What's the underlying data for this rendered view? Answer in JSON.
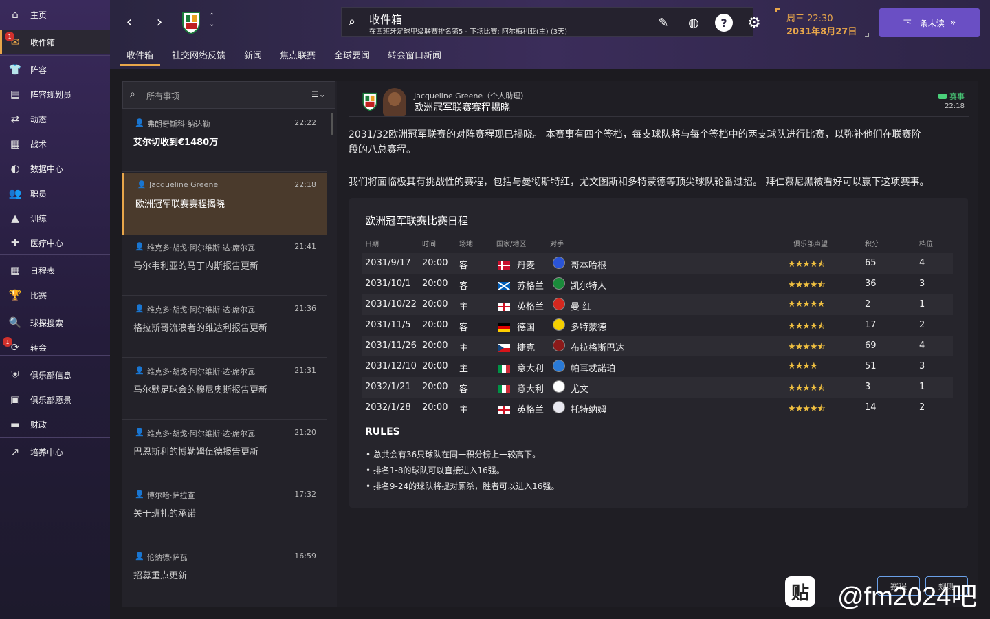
{
  "sidebar": {
    "items": [
      {
        "label": "主页",
        "icon": "home-icon",
        "glyph": "⌂"
      },
      {
        "label": "收件箱",
        "icon": "inbox-icon",
        "glyph": "✉",
        "badge": "1"
      },
      {
        "label": "阵容",
        "icon": "shirt-icon",
        "glyph": "👕"
      },
      {
        "label": "阵容规划员",
        "icon": "clipboard-icon",
        "glyph": "▤"
      },
      {
        "label": "动态",
        "icon": "dynamics-icon",
        "glyph": "⇄"
      },
      {
        "label": "战术",
        "icon": "tactics-icon",
        "glyph": "▦"
      },
      {
        "label": "数据中心",
        "icon": "data-icon",
        "glyph": "◐"
      },
      {
        "label": "职员",
        "icon": "staff-icon",
        "glyph": "👥"
      },
      {
        "label": "训练",
        "icon": "training-icon",
        "glyph": "▲"
      },
      {
        "label": "医疗中心",
        "icon": "medical-icon",
        "glyph": "✚"
      },
      {
        "label": "日程表",
        "icon": "calendar-icon",
        "glyph": "▦"
      },
      {
        "label": "比赛",
        "icon": "trophy-icon",
        "glyph": "🏆"
      },
      {
        "label": "球探搜索",
        "icon": "scout-icon",
        "glyph": "🔍"
      },
      {
        "label": "转会",
        "icon": "transfer-icon",
        "glyph": "⟳",
        "badge": "1"
      },
      {
        "label": "俱乐部信息",
        "icon": "shield-icon",
        "glyph": "⛨"
      },
      {
        "label": "俱乐部愿景",
        "icon": "briefcase-icon",
        "glyph": "▣"
      },
      {
        "label": "财政",
        "icon": "finance-icon",
        "glyph": "▬"
      },
      {
        "label": "培养中心",
        "icon": "development-icon",
        "glyph": "↗"
      }
    ]
  },
  "header": {
    "title": "收件箱",
    "subtitle": "在西班牙足球甲级联赛排名第5 - 下场比赛: 阿尔梅利亚(主) (3天)",
    "date_line1": "周三 22:30",
    "date_line2": "2031年8月27日",
    "next_label": "下一条未读",
    "tabs": [
      "收件箱",
      "社交网络反馈",
      "新闻",
      "焦点联赛",
      "全球要闻",
      "转会窗口新闻"
    ]
  },
  "inbox": {
    "search_placeholder": "所有事项",
    "messages": [
      {
        "sender": "弗朗奇斯科·纳达勒",
        "time": "22:22",
        "subject": "艾尔切收到€1480万",
        "bold": true
      },
      {
        "sender": "Jacqueline Greene",
        "time": "22:18",
        "subject": "欧洲冠军联赛赛程揭晓",
        "selected": true
      },
      {
        "sender": "维克多·胡戈·阿尔维斯·达·席尔瓦",
        "time": "21:41",
        "subject": "马尔韦利亚的马丁内斯报告更新"
      },
      {
        "sender": "维克多·胡戈·阿尔维斯·达·席尔瓦",
        "time": "21:36",
        "subject": "格拉斯哥流浪者的维达利报告更新"
      },
      {
        "sender": "维克多·胡戈·阿尔维斯·达·席尔瓦",
        "time": "21:31",
        "subject": "马尔默足球会的穆尼奥斯报告更新"
      },
      {
        "sender": "维克多·胡戈·阿尔维斯·达·席尔瓦",
        "time": "21:20",
        "subject": "巴恩斯利的博勒姆伍德报告更新"
      },
      {
        "sender": "博尔哈·萨拉查",
        "time": "17:32",
        "subject": "关于班扎的承诺"
      },
      {
        "sender": "伦纳德·萨瓦",
        "time": "16:59",
        "subject": "招募重点更新"
      }
    ]
  },
  "detail": {
    "from": "Jacqueline Greene（个人助理）",
    "title": "欧洲冠军联赛赛程揭晓",
    "tag": "赛事",
    "time": "22:18",
    "para1_line1": "2031/32欧洲冠军联赛的对阵赛程现已揭晓。 本赛事有四个签档，每支球队将与每个签档中的两支球队进行比赛，以弥补他们在联赛阶",
    "para1_line2": "段的八总赛程。",
    "para2": "我们将面临极其有挑战性的赛程，包括与曼彻斯特红，尤文图斯和多特蒙德等顶尖球队轮番过招。 拜仁慕尼黑被看好可以赢下这项赛事。",
    "fixtures_title": "欧洲冠军联赛比赛日程",
    "columns": [
      "日期",
      "时间",
      "场地",
      "国家/地区",
      "对手",
      "俱乐部声望",
      "积分",
      "档位"
    ],
    "fixtures": [
      {
        "date": "2031/9/17",
        "time": "20:00",
        "venue": "客",
        "country": "丹麦",
        "opponent": "哥本哈根",
        "stars": "★★★★⯪",
        "points": "65",
        "pot": "4",
        "flag": "dk",
        "logo": "#2a54d6"
      },
      {
        "date": "2031/10/1",
        "time": "20:00",
        "venue": "客",
        "country": "苏格兰",
        "opponent": "凯尔特人",
        "stars": "★★★★⯪",
        "points": "36",
        "pot": "3",
        "flag": "sc",
        "logo": "#1a8a3a"
      },
      {
        "date": "2031/10/22",
        "time": "20:00",
        "venue": "主",
        "country": "英格兰",
        "opponent": "曼 红",
        "stars": "★★★★★",
        "points": "2",
        "pot": "1",
        "flag": "en",
        "logo": "#d4281f"
      },
      {
        "date": "2031/11/5",
        "time": "20:00",
        "venue": "客",
        "country": "德国",
        "opponent": "多特蒙德",
        "stars": "★★★★⯪",
        "points": "17",
        "pot": "2",
        "flag": "de",
        "logo": "#f5d000"
      },
      {
        "date": "2031/11/26",
        "time": "20:00",
        "venue": "主",
        "country": "捷克",
        "opponent": "布拉格斯巴达",
        "stars": "★★★★⯪",
        "points": "69",
        "pot": "4",
        "flag": "cz",
        "logo": "#8b1a1a"
      },
      {
        "date": "2031/12/10",
        "time": "20:00",
        "venue": "主",
        "country": "意大利",
        "opponent": "帕耳忒諾珀",
        "stars": "★★★★",
        "points": "51",
        "pot": "3",
        "flag": "it",
        "logo": "#2a7ad6"
      },
      {
        "date": "2032/1/21",
        "time": "20:00",
        "venue": "客",
        "country": "意大利",
        "opponent": "尤文",
        "stars": "★★★★⯪",
        "points": "3",
        "pot": "1",
        "flag": "it",
        "logo": "#ffffff"
      },
      {
        "date": "2032/1/28",
        "time": "20:00",
        "venue": "主",
        "country": "英格兰",
        "opponent": "托特纳姆",
        "stars": "★★★★⯪",
        "points": "14",
        "pot": "2",
        "flag": "en",
        "logo": "#e8e8f0"
      }
    ],
    "rules_title": "RULES",
    "rules": [
      "• 总共会有36只球队在同一积分榜上一较高下。",
      "• 排名1-8的球队可以直接进入16强。",
      "• 排名9-24的球队将捉对厮杀，胜者可以进入16强。"
    ],
    "footer_buttons": [
      "赛程",
      "规则"
    ]
  },
  "watermark": "@fm2024吧"
}
